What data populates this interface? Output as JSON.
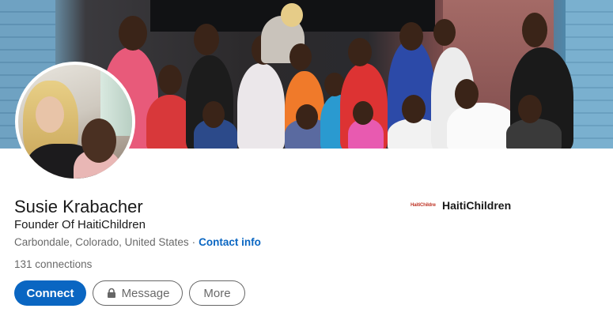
{
  "profile": {
    "name": "Susie Krabacher",
    "headline": "Founder Of HaitiChildren",
    "location": "Carbondale, Colorado, United States",
    "separator": "·",
    "contact_label": "Contact info",
    "connections_count": "131",
    "connections_label": "connections"
  },
  "company": {
    "logo_text": "HaitiChildren",
    "name": "HaitiChildren"
  },
  "actions": {
    "connect_label": "Connect",
    "message_label": "Message",
    "more_label": "More"
  },
  "colors": {
    "accent": "#0a66c2",
    "text_primary": "rgba(0,0,0,0.9)",
    "text_secondary": "rgba(0,0,0,0.6)"
  },
  "icons": {
    "message_button": "lock-icon"
  }
}
